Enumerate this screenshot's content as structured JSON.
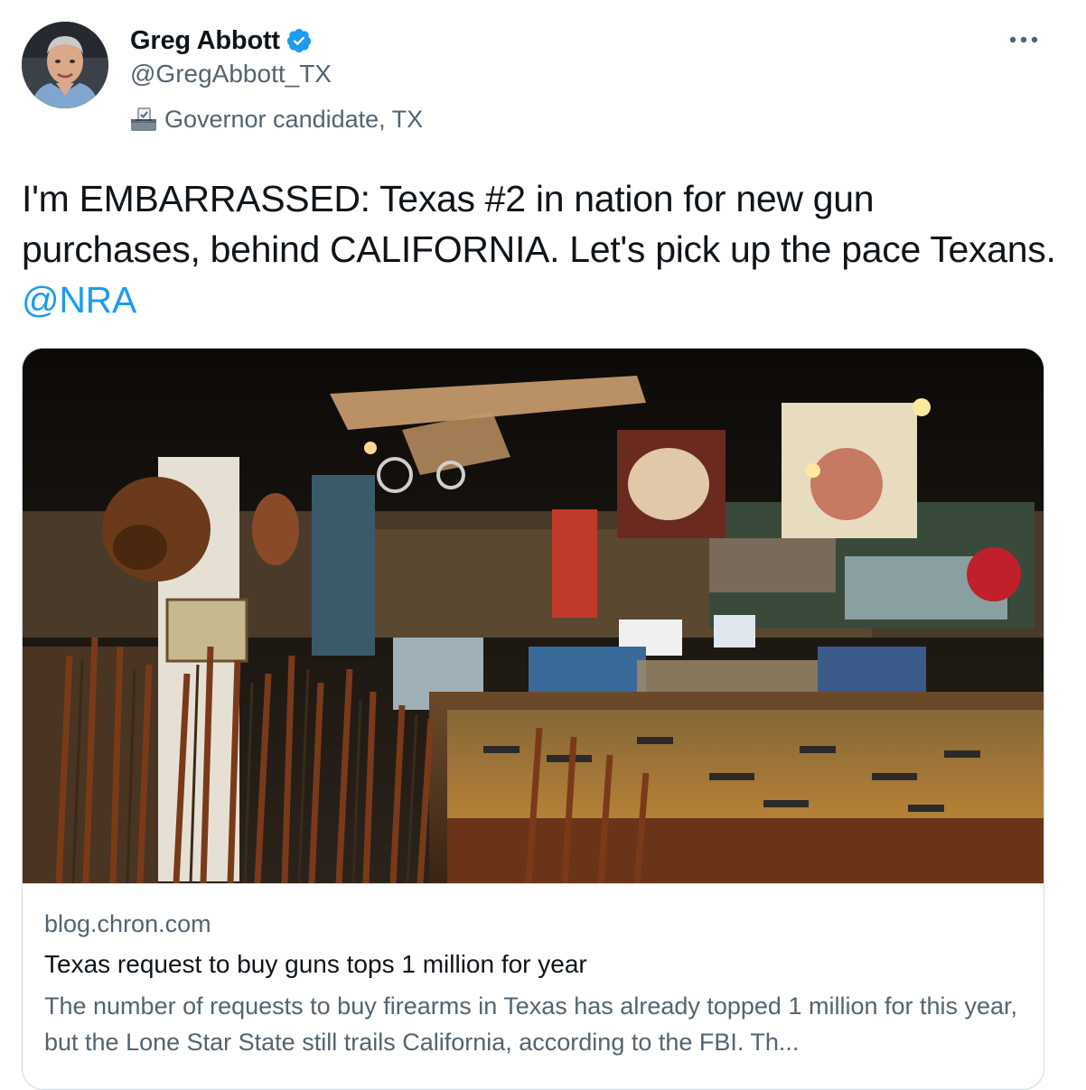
{
  "author": {
    "display_name": "Greg Abbott",
    "handle": "@GregAbbott_TX",
    "verified": true,
    "label": "Governor candidate, TX",
    "label_icon": "ballot-box-icon",
    "avatar_icon": "profile-photo"
  },
  "menu": {
    "icon": "more-horizontal-icon",
    "glyph": "···"
  },
  "tweet": {
    "text": "I'm EMBARRASSED: Texas #2 in nation for new gun purchases, behind CALIFORNIA. Let's pick up the pace Texans. ",
    "mention": "@NRA"
  },
  "card": {
    "domain": "blog.chron.com",
    "title": "Texas request to buy guns tops 1 million for year",
    "description": "The number of requests to buy firearms in Texas has already topped 1 million for this year, but the Lone Star State still trails California, according to the FBI. Th...",
    "image": "gun-store-interior-photo"
  },
  "colors": {
    "text": "#0f1419",
    "secondary": "#536471",
    "link": "#1d9bf0",
    "border": "#cfd9de",
    "verified": "#1d9bf0"
  }
}
